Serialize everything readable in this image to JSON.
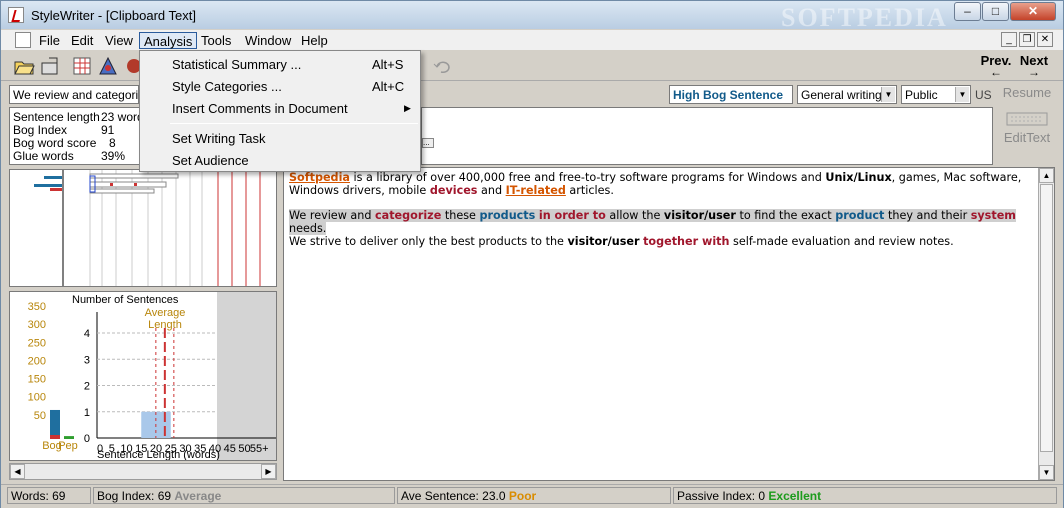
{
  "window": {
    "title": "StyleWriter - [Clipboard Text]",
    "watermark": "SOFTPEDIA",
    "controls": [
      "minimize",
      "maximize",
      "close"
    ]
  },
  "menubar": {
    "items": [
      "File",
      "Edit",
      "View",
      "Analysis",
      "Tools",
      "Window",
      "Help"
    ],
    "active": "Analysis"
  },
  "analysis_menu": {
    "items": [
      {
        "label": "Statistical Summary ...",
        "shortcut": "Alt+S"
      },
      {
        "label": "Style Categories ...",
        "shortcut": "Alt+C"
      },
      {
        "label": "Insert Comments in Document",
        "submenu": true
      },
      {
        "label": "Set Writing Task"
      },
      {
        "label": "Set Audience"
      }
    ]
  },
  "toolbar": {
    "prev_label": "Prev.",
    "next_label": "Next",
    "resume_label": "Resume",
    "edit_text_label": "EditText"
  },
  "sentence_bar": {
    "sentence": "We review and categorize",
    "rating": "High Bog Sentence",
    "writing_type": "General writing",
    "audience": "Public",
    "locale": "US"
  },
  "stats": [
    {
      "label": "Sentence length",
      "value": "23 words"
    },
    {
      "label": "Bog Index",
      "value": "91"
    },
    {
      "label": "Bog word score",
      "value": "8"
    },
    {
      "label": "Glue words",
      "value": "39%"
    }
  ],
  "chart_data": {
    "type": "bar",
    "title": "Number of Sentences",
    "annotation": "Average Length",
    "xlabel": "Sentence Length (words)",
    "x_ticks": [
      "0",
      "5",
      "10",
      "15",
      "20",
      "25",
      "30",
      "35",
      "40",
      "45",
      "50",
      "55+"
    ],
    "y_ticks": [
      "1",
      "2",
      "3",
      "4"
    ],
    "left_scale": [
      "350",
      "300",
      "250",
      "200",
      "150",
      "100",
      "50"
    ],
    "left_bars": [
      {
        "name": "Bog",
        "value": 80,
        "color": "#1f6f9f"
      },
      {
        "name": "Pep",
        "value": 8,
        "color": "#2f9e2f"
      }
    ],
    "bars": [
      {
        "range": [
          15,
          25
        ],
        "count": 1
      }
    ],
    "average_length": 23,
    "ylim": [
      0,
      4.8
    ]
  },
  "text": {
    "para1": [
      {
        "t": "Softpedia",
        "s": "orange"
      },
      {
        "t": " is a library of over 400,000 free and free-to-try software programs for Windows and "
      },
      {
        "t": "Unix/Linux",
        "s": "black"
      },
      {
        "t": ", games, Mac software, Windows drivers, mobile "
      },
      {
        "t": "devices",
        "s": "red"
      },
      {
        "t": " and "
      },
      {
        "t": "IT-related",
        "s": "orange"
      },
      {
        "t": " articles."
      }
    ],
    "para2_line1": [
      {
        "t": "We review and "
      },
      {
        "t": "categorize",
        "s": "red"
      },
      {
        "t": " these "
      },
      {
        "t": "products",
        "s": "blue"
      },
      {
        "t": " "
      },
      {
        "t": "in order to",
        "s": "red"
      },
      {
        "t": " allow the "
      },
      {
        "t": "visitor/user",
        "s": "black"
      },
      {
        "t": " to find the exact "
      },
      {
        "t": "product",
        "s": "blue"
      },
      {
        "t": " they and their "
      },
      {
        "t": "system",
        "s": "red"
      },
      {
        "t": " needs."
      }
    ],
    "para2_line2": [
      {
        "t": "We strive to deliver only the best products to the "
      },
      {
        "t": "visitor/user",
        "s": "black"
      },
      {
        "t": " "
      },
      {
        "t": "together with",
        "s": "red"
      },
      {
        "t": " self-made evaluation and review notes."
      }
    ]
  },
  "statusbar": {
    "words": "Words: 69",
    "bog_index": "Bog Index: 69",
    "bog_rating": "Average",
    "ave_sentence": "Ave Sentence: 23.0",
    "ave_rating": "Poor",
    "passive_index": "Passive Index: 0",
    "passive_rating": "Excellent"
  }
}
